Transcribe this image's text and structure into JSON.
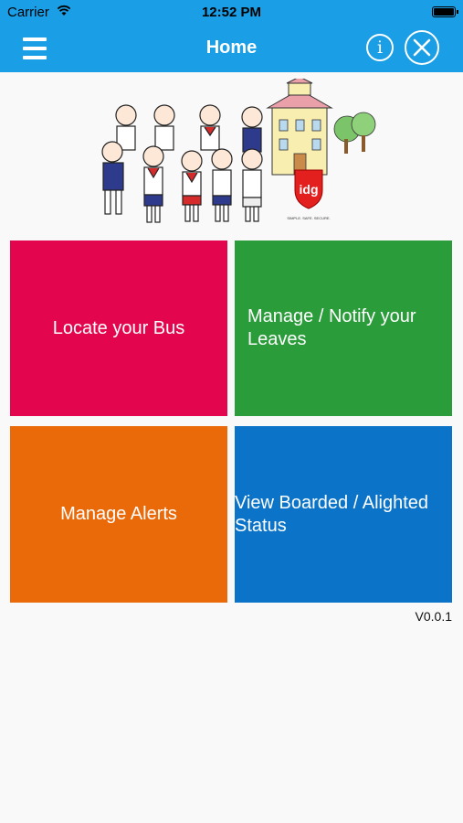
{
  "status_bar": {
    "carrier": "Carrier",
    "time": "12:52 PM"
  },
  "nav": {
    "title": "Home",
    "menu_icon": "hamburger-menu-icon",
    "info_icon": "info-icon",
    "close_icon": "close-icon",
    "color": "#1a9ee6"
  },
  "banner": {
    "logo_text": "idg",
    "tagline": "SIMPLE. SAFE. SECURE."
  },
  "tiles": [
    {
      "label": "Locate your Bus",
      "color": "#e3064e"
    },
    {
      "label": "Manage / Notify your Leaves",
      "color": "#2a9d3a"
    },
    {
      "label": "Manage Alerts",
      "color": "#ea6a0a"
    },
    {
      "label": "View Boarded / Alighted Status",
      "color": "#0b74c9"
    }
  ],
  "version": "V0.0.1"
}
